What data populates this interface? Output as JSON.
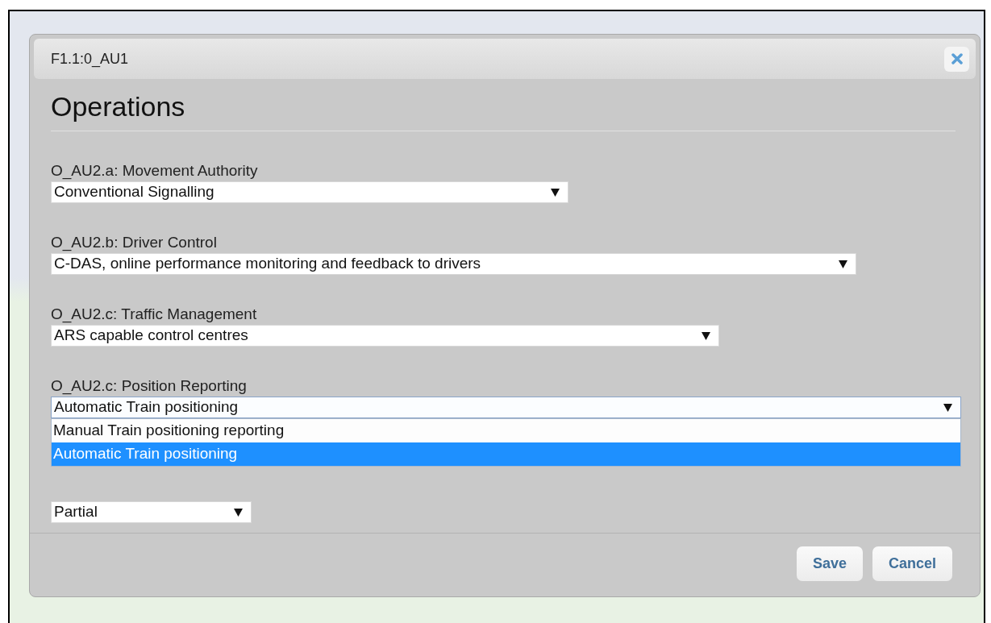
{
  "dialog": {
    "title": "F1.1:0_AU1",
    "heading": "Operations",
    "fields": [
      {
        "label": "O_AU2.a: Movement Authority",
        "value": "Conventional Signalling",
        "open": false
      },
      {
        "label": "O_AU2.b: Driver Control",
        "value": "C-DAS, online performance monitoring and feedback to drivers",
        "open": false
      },
      {
        "label": "O_AU2.c: Traffic Management",
        "value": "ARS capable control centres",
        "open": false
      },
      {
        "label": "O_AU2.c: Position Reporting",
        "value": "Automatic Train positioning",
        "open": true,
        "options": [
          {
            "label": "Manual Train positioning reporting",
            "selected": false
          },
          {
            "label": "Automatic Train positioning",
            "selected": true
          }
        ]
      },
      {
        "value": "Partial",
        "open": false
      }
    ],
    "buttons": [
      "Save",
      "Cancel"
    ]
  }
}
